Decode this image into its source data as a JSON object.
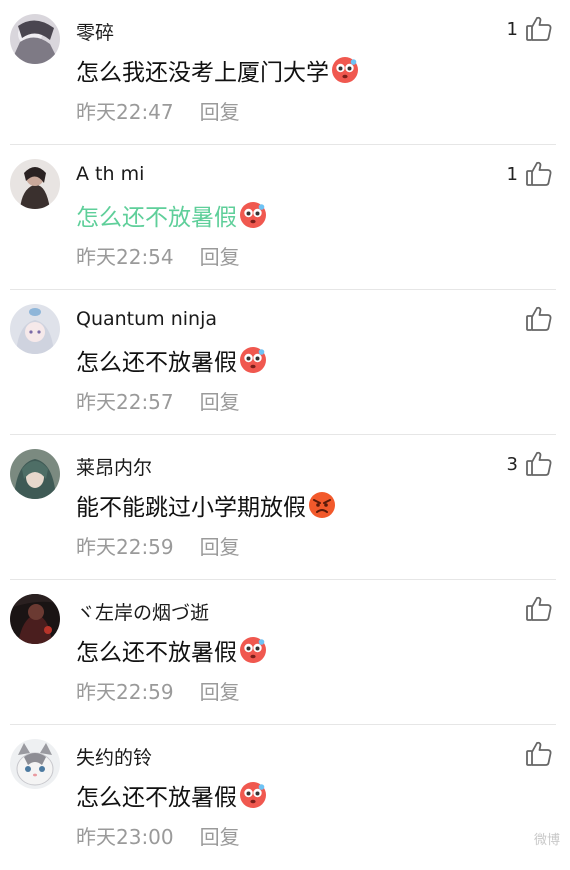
{
  "comments": [
    {
      "username": "零碎",
      "text": "怎么我还没考上厦门大学",
      "emoji": "flushed-emoji",
      "time": "昨天22:47",
      "reply": "回复",
      "likes": "1",
      "highlight": false
    },
    {
      "username": "A th mi",
      "text": "怎么还不放暑假",
      "emoji": "flushed-emoji",
      "time": "昨天22:54",
      "reply": "回复",
      "likes": "1",
      "highlight": true
    },
    {
      "username": "Quantum ninja",
      "text": "怎么还不放暑假",
      "emoji": "flushed-emoji",
      "time": "昨天22:57",
      "reply": "回复",
      "likes": "",
      "highlight": false
    },
    {
      "username": "莱昂内尔",
      "text": "能不能跳过小学期放假",
      "emoji": "angry-emoji",
      "time": "昨天22:59",
      "reply": "回复",
      "likes": "3",
      "highlight": false
    },
    {
      "username": "ヾ左岸の烟づ逝",
      "text": "怎么还不放暑假",
      "emoji": "flushed-emoji",
      "time": "昨天22:59",
      "reply": "回复",
      "likes": "",
      "highlight": false
    },
    {
      "username": "失约的铃",
      "text": "怎么还不放暑假",
      "emoji": "flushed-emoji",
      "time": "昨天23:00",
      "reply": "回复",
      "likes": "",
      "highlight": false
    }
  ],
  "icons": {
    "like": "thumbs-up-icon"
  },
  "colors": {
    "highlight_text": "#5fcf9a",
    "meta_text": "#9a9a9a",
    "divider": "#e6e6e6"
  },
  "watermark": "微博"
}
